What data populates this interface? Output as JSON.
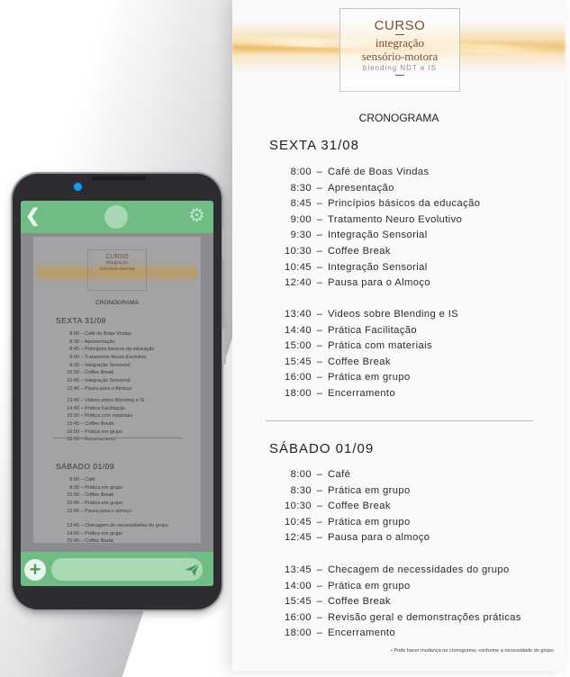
{
  "document": {
    "logo": {
      "title": "CURSO",
      "line1": "integração",
      "line2": "sensório-motora",
      "line3": "blending NDT e IS"
    },
    "heading": "CRONOGRAMA",
    "days": [
      {
        "title": "SEXTA 31/08",
        "blocks": [
          [
            {
              "time": "8:00",
              "activity": "Café de Boas Vindas"
            },
            {
              "time": "8:30",
              "activity": "Apresentação"
            },
            {
              "time": "8:45",
              "activity": "Princípios básicos da educação"
            },
            {
              "time": "9:00",
              "activity": "Tratamento Neuro Evolutivo"
            },
            {
              "time": "9:30",
              "activity": "Integração Sensorial"
            },
            {
              "time": "10:30",
              "activity": "Coffee Break"
            },
            {
              "time": "10:45",
              "activity": "Integração Sensorial"
            },
            {
              "time": "12:40",
              "activity": "Pausa para o Almoço"
            }
          ],
          [
            {
              "time": "13:40",
              "activity": "Videos sobre Blending e IS"
            },
            {
              "time": "14:40",
              "activity": "Prática Facilitação"
            },
            {
              "time": "15:00",
              "activity": "Prática com materiais"
            },
            {
              "time": "15:45",
              "activity": "Coffee Break"
            },
            {
              "time": "16:00",
              "activity": "Prática em grupo"
            },
            {
              "time": "18:00",
              "activity": "Encerramento"
            }
          ]
        ]
      },
      {
        "title": "SÁBADO 01/09",
        "blocks": [
          [
            {
              "time": "8:00",
              "activity": "Café"
            },
            {
              "time": "8:30",
              "activity": "Prática em grupo"
            },
            {
              "time": "10:30",
              "activity": "Coffee Break"
            },
            {
              "time": "10:45",
              "activity": "Prática em grupo"
            },
            {
              "time": "12:45",
              "activity": "Pausa para o almoço"
            }
          ],
          [
            {
              "time": "13:45",
              "activity": "Checagem de necessidades do grupo"
            },
            {
              "time": "14:00",
              "activity": "Prática em grupo"
            },
            {
              "time": "15:45",
              "activity": "Coffee Break"
            },
            {
              "time": "16:00",
              "activity": "Revisão geral e demonstrações práticas"
            },
            {
              "time": "18:00",
              "activity": "Encerramento"
            }
          ]
        ]
      }
    ],
    "note": "• Pode haver mudança no cronograma, conforme a necessidade do grupo."
  },
  "phone": {
    "top_bar": {
      "back_icon": "chevron-left-icon",
      "settings_icon": "gear-icon"
    },
    "bottom_bar": {
      "add_icon": "plus-icon",
      "send_icon": "send-icon",
      "input_value": ""
    },
    "accent_color": "#6fbc85",
    "camera_color": "#1e9be8"
  },
  "colors": {
    "logo_text": "#7a4e34",
    "gold": "#e6a028"
  }
}
